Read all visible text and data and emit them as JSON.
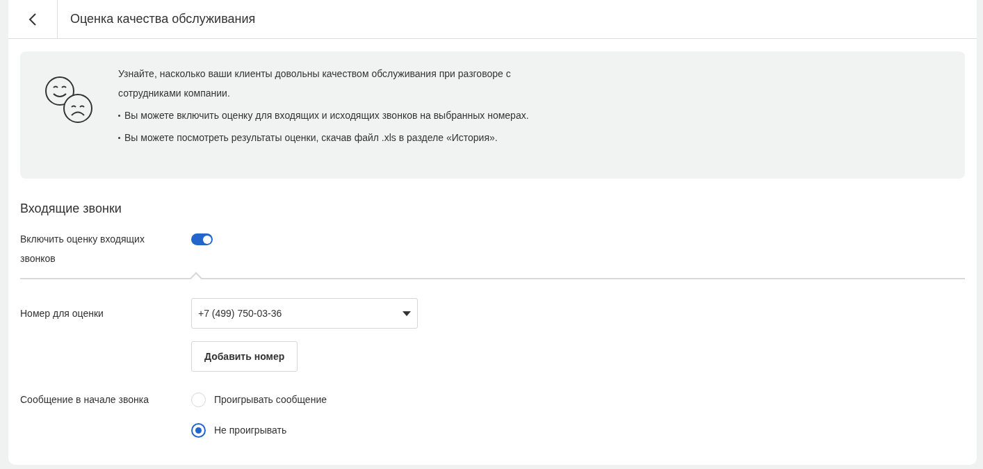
{
  "header": {
    "title": "Оценка качества обслуживания"
  },
  "info": {
    "intro": "Узнайте, насколько ваши клиенты довольны качеством обслуживания при разговоре с сотрудниками компании.",
    "bullets": [
      "Вы можете включить оценку для входящих и исходящих звонков на выбранных номерах.",
      "Вы можете посмотреть результаты оценки, скачав файл .xls в разделе «История»."
    ]
  },
  "section": {
    "title": "Входящие звонки",
    "enable": {
      "label": "Включить оценку входящих звонков",
      "on": true
    },
    "number": {
      "label": "Номер для оценки",
      "value": "+7 (499) 750-03-36"
    },
    "add_button": "Добавить номер",
    "message": {
      "label": "Сообщение в начале звонка",
      "options": [
        {
          "label": "Проигрывать сообщение",
          "selected": false
        },
        {
          "label": "Не проигрывать",
          "selected": true
        }
      ]
    }
  }
}
